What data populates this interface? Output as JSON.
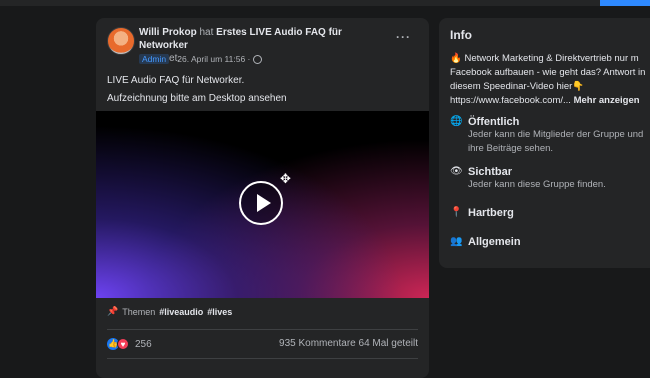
{
  "post": {
    "author": "Willi Prokop",
    "verb": "hat",
    "event_title": "Erstes LIVE Audio FAQ für Networker",
    "verb_suffix": "gepostet.",
    "badge": "Admin",
    "date": "· 26. April um 11:56 ·",
    "more_label": "···",
    "text_line1": "LIVE Audio FAQ für Networker.",
    "text_line2": "Aufzeichnung bitte am Desktop ansehen",
    "topics_label": "Themen",
    "tags": [
      "#liveaudio",
      "#lives"
    ],
    "reaction_count": "256",
    "comments": "935 Kommentare",
    "shares": "64 Mal geteilt"
  },
  "info": {
    "title": "Info",
    "desc_line1": "🔥 Network Marketing & Direktvertrieb nur m",
    "desc_line2": "Facebook aufbauen - wie geht das? Antwort in",
    "desc_line3": "diesem Speedinar-Video hier👇",
    "desc_line4": "https://www.facebook.com/...",
    "desc_more": "Mehr anzeigen",
    "public_title": "Öffentlich",
    "public_line1": "Jeder kann die Mitglieder der Gruppe und",
    "public_line2": "ihre Beiträge sehen.",
    "visible_title": "Sichtbar",
    "visible_line1": "Jeder kann diese Gruppe finden.",
    "location": "Hartberg",
    "category": "Allgemein"
  },
  "colors": {
    "background": "#18191a",
    "card": "#242526",
    "accent": "#2e89ff"
  }
}
